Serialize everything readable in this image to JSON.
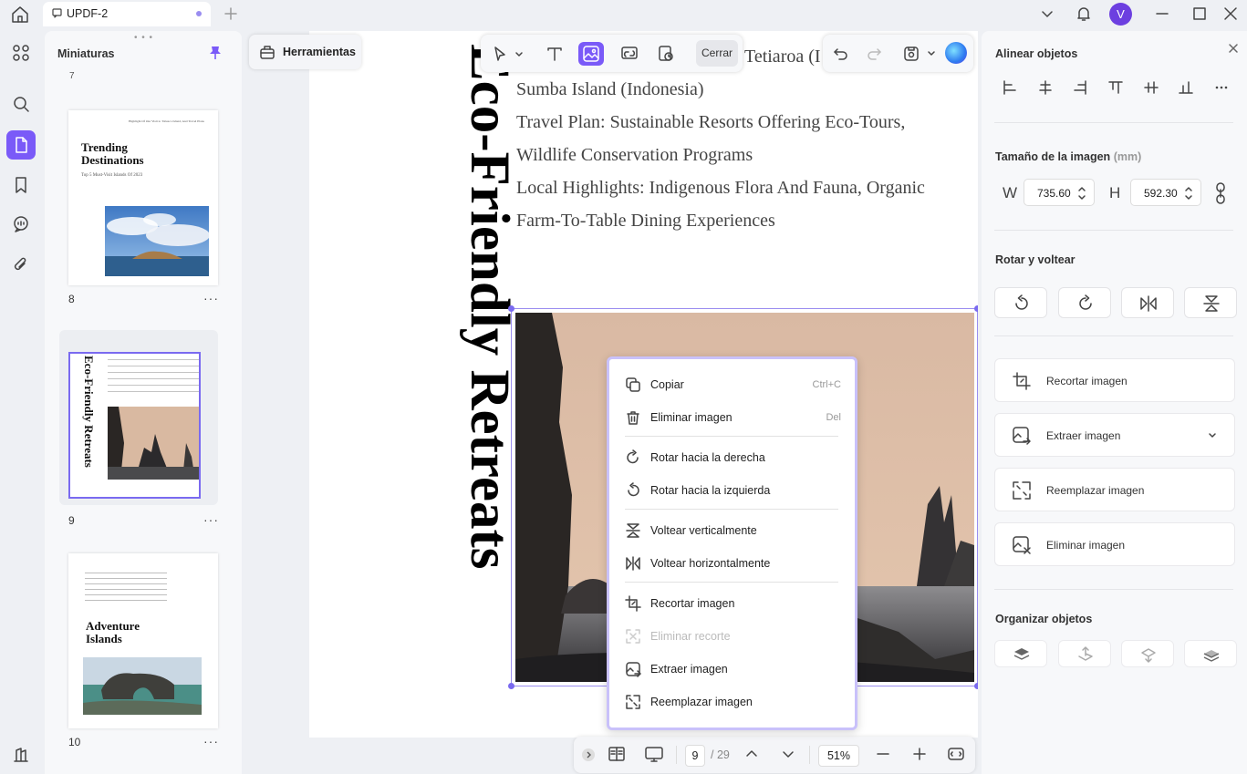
{
  "titlebar": {
    "tab_title": "UPDF-2",
    "avatar_letter": "V"
  },
  "thumbnails": {
    "title": "Miniaturas",
    "prev_page_number": "7",
    "pages": [
      {
        "number": "8",
        "heading_line1": "Trending",
        "heading_line2": "Destinations",
        "subtitle": "Top 5 Must-Visit Islands Of 2023",
        "top_text": "Highlight Of Our Visit to Tabasco Island, And Travel Plans"
      },
      {
        "number": "9",
        "heading": "Eco-Friendly Retreats"
      },
      {
        "number": "10",
        "heading_line1": "Adventure",
        "heading_line2": "Islands"
      }
    ],
    "more": "···"
  },
  "toolbar": {
    "tools_label": "Herramientas",
    "close_label": "Cerrar"
  },
  "document": {
    "vertical_title": "Eco-Friendly Retreats",
    "lines": [
      "Tetiaroa (I",
      "Sumba Island (Indonesia)",
      "Travel Plan: Sustainable Resorts Offering Eco-Tours,",
      "Wildlife Conservation Programs",
      "Local Highlights: Indigenous Flora And Fauna, Organic",
      "Farm-To-Table Dining Experiences"
    ]
  },
  "context_menu": {
    "items": [
      {
        "label": "Copiar",
        "shortcut": "Ctrl+C"
      },
      {
        "label": "Eliminar imagen",
        "shortcut": "Del"
      },
      {
        "label": "Rotar hacia la derecha"
      },
      {
        "label": "Rotar hacia la izquierda"
      },
      {
        "label": "Voltear verticalmente"
      },
      {
        "label": "Voltear horizontalmente"
      },
      {
        "label": "Recortar imagen"
      },
      {
        "label": "Eliminar recorte",
        "disabled": true
      },
      {
        "label": "Extraer imagen"
      },
      {
        "label": "Reemplazar imagen"
      }
    ]
  },
  "bottom_bar": {
    "page_current": "9",
    "page_total": "/ 29",
    "zoom": "51%"
  },
  "right_panel": {
    "align_title": "Alinear objetos",
    "size_title": "Tamaño de la imagen",
    "size_unit": "(mm)",
    "width_label": "W",
    "width_value": "735.60",
    "height_label": "H",
    "height_value": "592.30",
    "rotate_title": "Rotar y voltear",
    "actions": [
      "Recortar imagen",
      "Extraer imagen",
      "Reemplazar imagen",
      "Eliminar imagen"
    ],
    "organize_title": "Organizar objetos"
  },
  "colors": {
    "accent": "#7a5af8",
    "selection": "#9a8df0"
  }
}
